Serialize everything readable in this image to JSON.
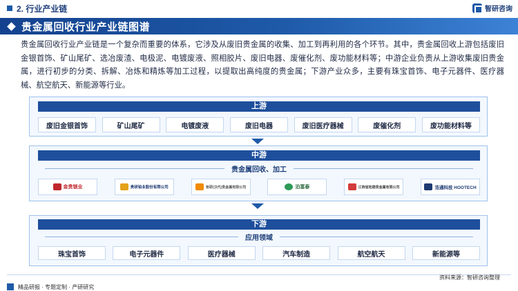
{
  "header": {
    "section": "2. 行业产业链",
    "brand": "智研咨询"
  },
  "title": "贵金属回收行业产业链图谱",
  "intro": "贵金属回收行业产业链是一个复杂而重要的体系，它涉及从废旧贵金属的收集、加工到再利用的各个环节。其中，贵金属回收上游包括废旧金银首饰、矿山尾矿、选冶废渣、电极泥、电镀废液、照相胶片、废旧电器、废催化剂、废功能材料等；中游企业负责从上游收集废旧贵金属，进行初步的分类、拆解、冶炼和精炼等加工过程，以提取出高纯度的贵金属；下游产业众多，主要有珠宝首饰、电子元器件、医疗器械、航空航天、新能源等行业。",
  "upstream": {
    "label": "上游",
    "items": [
      "废旧金银首饰",
      "矿山尾矿",
      "电镀废液",
      "废旧电器",
      "废旧医疗器械",
      "废催化剂",
      "废功能材料等"
    ]
  },
  "midstream": {
    "label": "中游",
    "sub": "贵金属回收、加工",
    "logos": [
      {
        "icon": "crown-logo-icon",
        "text": "金贵银业",
        "color": "#c0272d"
      },
      {
        "icon": "sino-platinum-logo-icon",
        "text": "贵研铂业股份有限公司",
        "color": "#e3a21a"
      },
      {
        "icon": "kf-logo-icon",
        "text": "有研(汉代)贵金属有限公司",
        "color": "#f08a00"
      },
      {
        "icon": "globe-logo-icon",
        "text": "泊富泰",
        "color": "#2f9a57"
      },
      {
        "icon": "jiangxi-logo-icon",
        "text": "江西省拓德贵金属有限公司",
        "color": "#d23b3b"
      },
      {
        "icon": "hootech-logo-icon",
        "text": "浩通科技 HOOTECH",
        "color": "#1d3a72"
      }
    ]
  },
  "downstream": {
    "label": "下游",
    "sub": "应用领域",
    "items": [
      "珠宝首饰",
      "电子元器件",
      "医疗器械",
      "汽车制造",
      "航空航天",
      "新能源等"
    ]
  },
  "footer": {
    "source": "资料来源：智研咨询整理",
    "tagline": "精品研报 · 专题定制 · 产研研究"
  },
  "colors": {
    "primary": "#1e5aa8",
    "header": "#1e4f9c",
    "panel": "#f3f8fe"
  }
}
